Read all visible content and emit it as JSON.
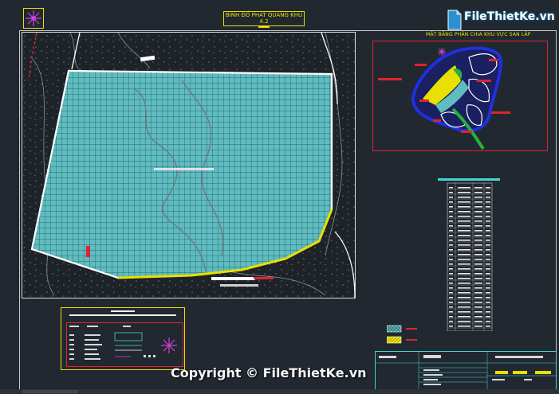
{
  "drawing": {
    "title": "BÌNH ĐỒ PHÁT QUANG KHU 4.2",
    "inset_title": "MẶT BẰNG PHÂN CHIA KHU VỰC SAN LẤP"
  },
  "watermark": {
    "brand": "FileThietKe.vn",
    "copyright": "Copyright © FileThietKe.vn"
  },
  "colors": {
    "background": "#212830",
    "grid_fill": "#5fbcc0",
    "grid_line": "#1a4a50",
    "frame_red": "#e0242c",
    "frame_yellow": "#e8e000",
    "title_block_cyan": "#46d4d4",
    "boundary_white": "#ffffff"
  },
  "icons": {
    "logo": "north-arrow-icon",
    "inset_marker": "star-icon",
    "legend_marker": "star-icon"
  }
}
